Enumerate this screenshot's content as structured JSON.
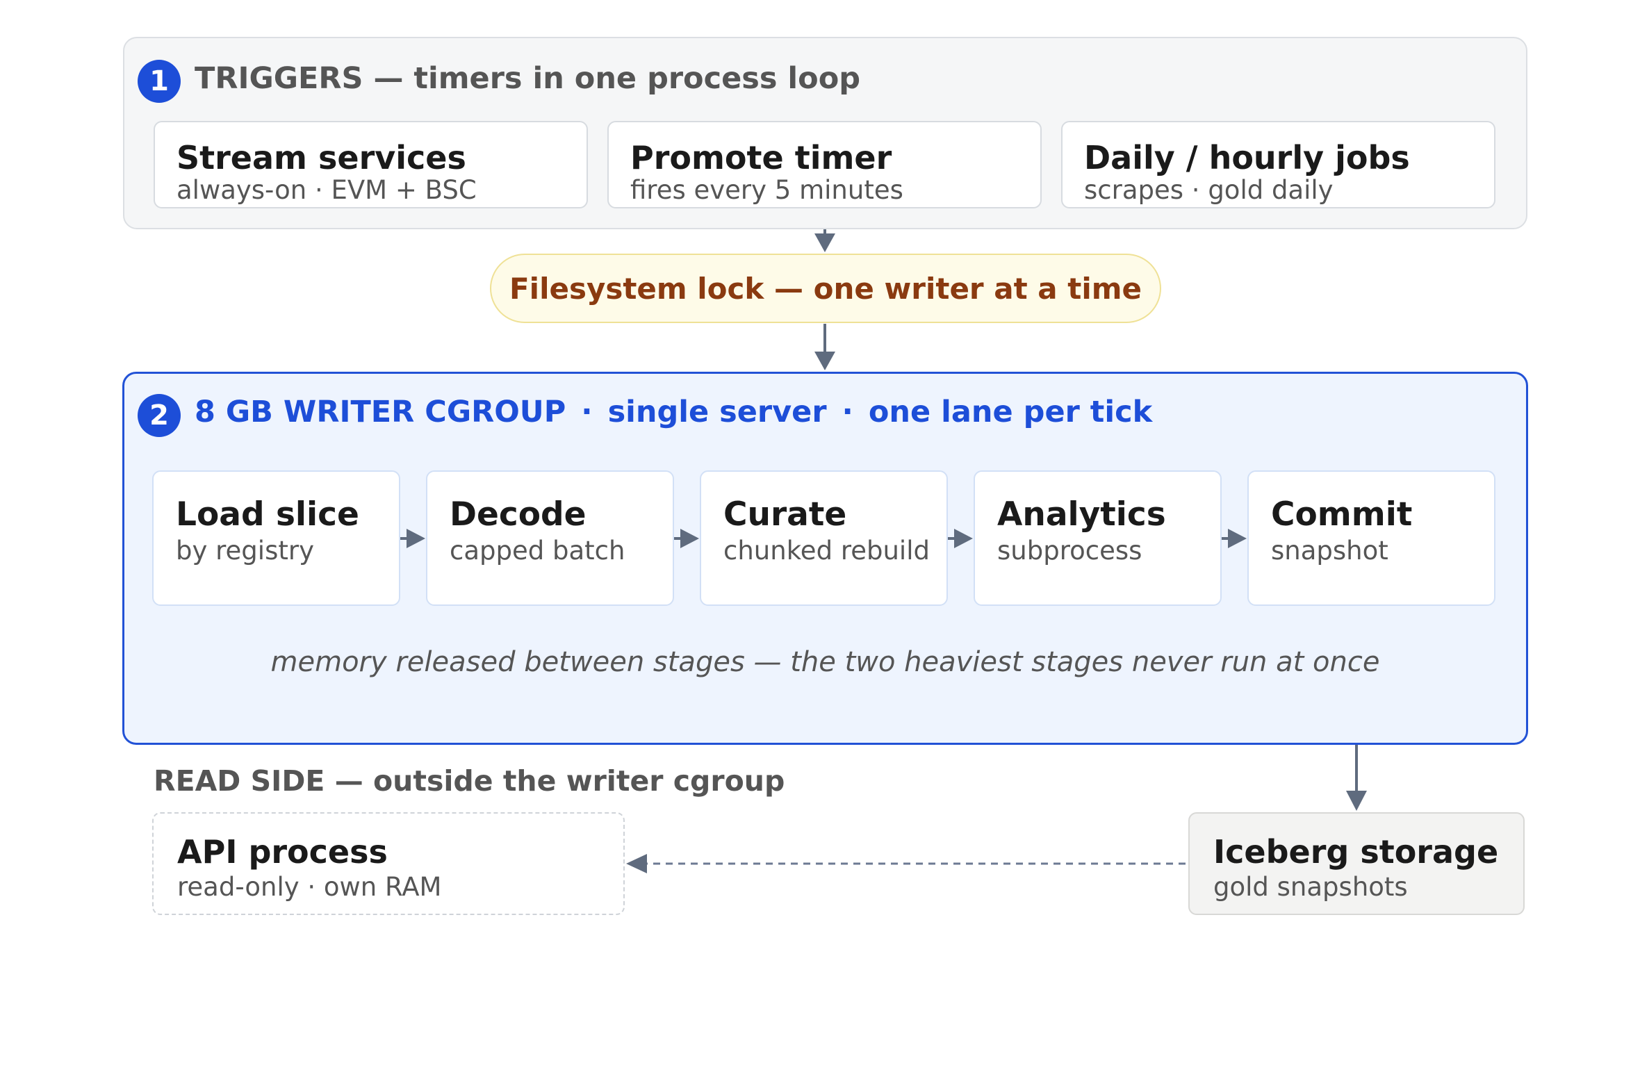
{
  "triggers": {
    "badge": "1",
    "title": "TRIGGERS — timers in one process loop",
    "cards": [
      {
        "title": "Stream services",
        "subtitle": "always-on · EVM + BSC"
      },
      {
        "title": "Promote timer",
        "subtitle": "fires every 5 minutes"
      },
      {
        "title": "Daily / hourly jobs",
        "subtitle": "scrapes · gold daily"
      }
    ]
  },
  "lock": {
    "label": "Filesystem lock — one writer at a time"
  },
  "writer": {
    "badge": "2",
    "title_parts": [
      "8 GB WRITER CGROUP",
      "single server",
      "one lane per tick"
    ],
    "separator": "·",
    "stages": [
      {
        "title": "Load slice",
        "subtitle": "by registry"
      },
      {
        "title": "Decode",
        "subtitle": "capped batch"
      },
      {
        "title": "Curate",
        "subtitle": "chunked rebuild"
      },
      {
        "title": "Analytics",
        "subtitle": "subprocess"
      },
      {
        "title": "Commit",
        "subtitle": "snapshot"
      }
    ],
    "note": "memory released between stages — the two heaviest stages never run at once"
  },
  "read_side": {
    "title": "READ SIDE — outside the writer cgroup",
    "api": {
      "title": "API process",
      "subtitle": "read-only · own RAM"
    },
    "storage": {
      "title": "Iceberg storage",
      "subtitle": "gold snapshots"
    }
  },
  "colors": {
    "accent_blue": "#1d4ed8",
    "arrow": "#5f6b7e",
    "lock_text": "#8a3a10",
    "lock_fill": "#fefbe8",
    "writer_fill": "#eef4fe"
  }
}
